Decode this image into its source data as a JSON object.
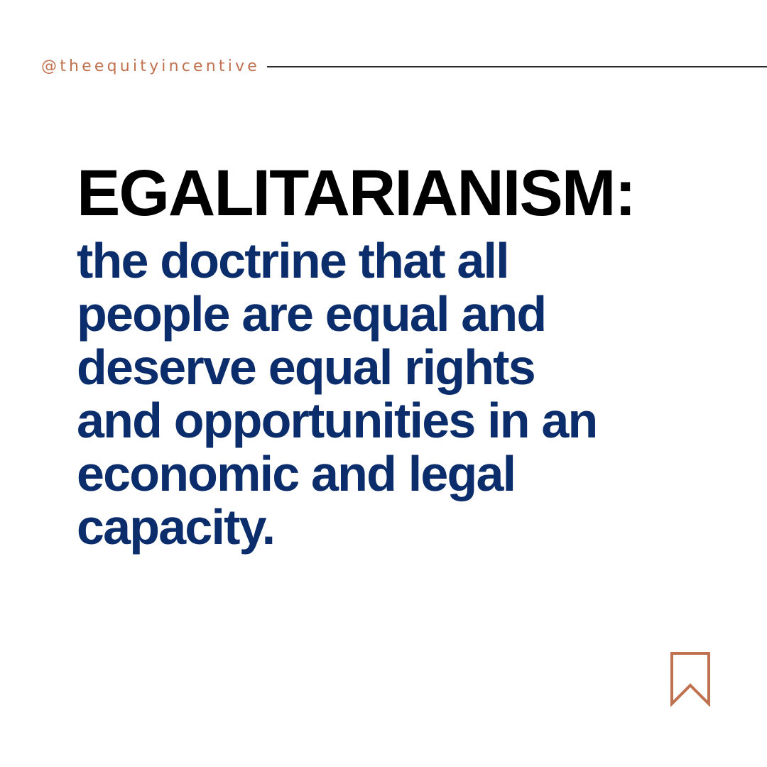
{
  "header": {
    "handle": "@theequityincentive"
  },
  "main": {
    "term": "EGALITARIANISM:",
    "definition_lines": [
      "the doctrine that all",
      "people are equal and",
      "deserve equal rights",
      "and opportunities in an",
      "economic and legal",
      "capacity."
    ]
  },
  "footer": {
    "icon": "bookmark-icon"
  },
  "colors": {
    "accent": "#c0714f",
    "term": "#000000",
    "definition": "#0b2d6b",
    "rule": "#2a2a2a",
    "background": "#ffffff"
  }
}
